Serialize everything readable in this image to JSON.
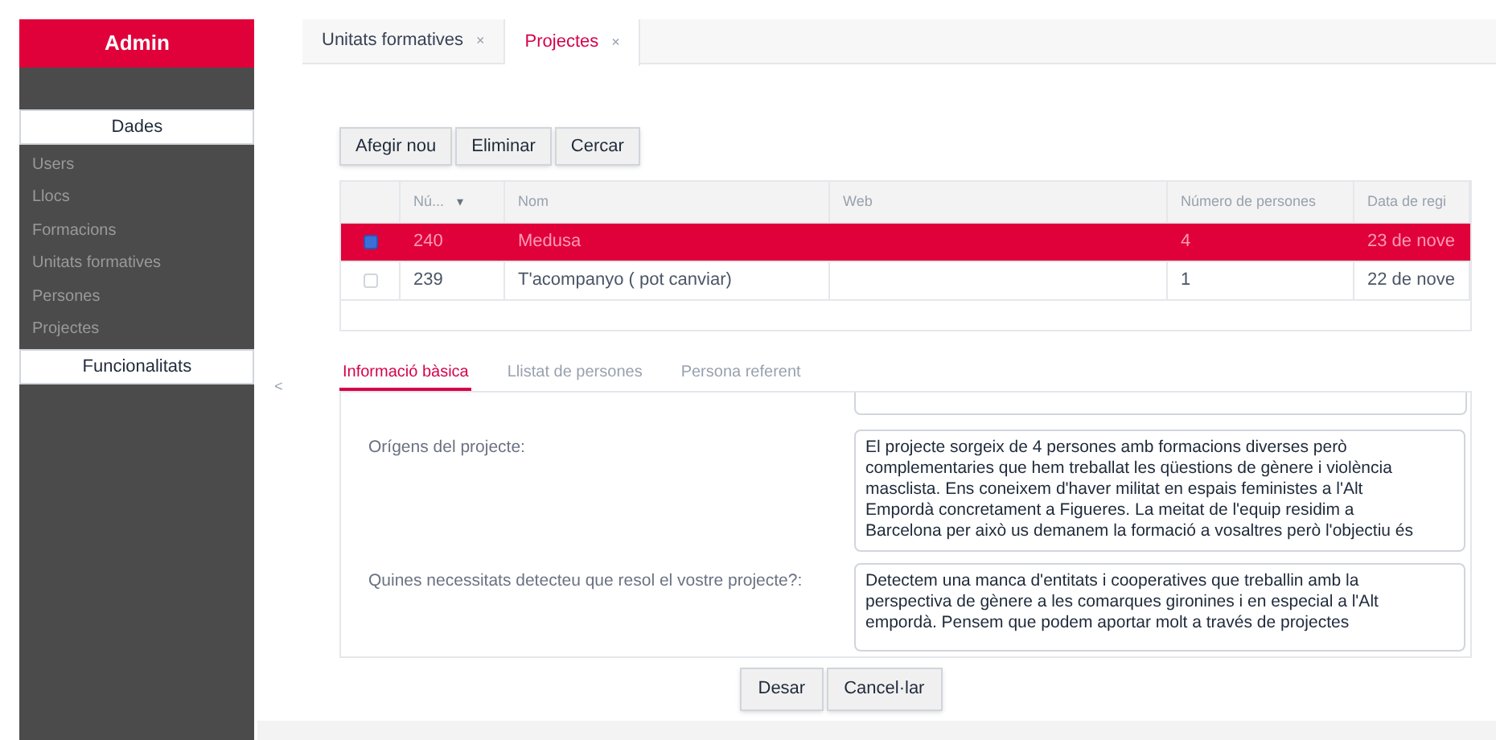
{
  "sidebar": {
    "title": "Admin",
    "sections": [
      {
        "label": "Dades",
        "items": [
          "Users",
          "Llocs",
          "Formacions",
          "Unitats formatives",
          "Persones",
          "Projectes"
        ]
      },
      {
        "label": "Funcionalitats"
      }
    ],
    "collapse_toggle": "<"
  },
  "tabs": [
    {
      "label": "Unitats formatives",
      "close": "×",
      "selected": false
    },
    {
      "label": "Projectes",
      "close": "×",
      "selected": true
    }
  ],
  "toolbar": [
    "Afegir nou",
    "Eliminar",
    "Cercar"
  ],
  "table": {
    "columns": [
      "",
      "Nú...",
      "Nom",
      "Web",
      "Número de persones",
      "Data de regi"
    ],
    "sort_indicator": "▾",
    "rows": [
      {
        "selected": true,
        "cells": [
          "",
          "240",
          "Medusa",
          "",
          "4",
          "23 de nove"
        ]
      },
      {
        "selected": false,
        "cells": [
          "",
          "239",
          "T'acompanyo ( pot canviar)",
          "",
          "1",
          "22 de nove"
        ]
      }
    ]
  },
  "detail_tabs": [
    {
      "label": "Informació bàsica",
      "selected": true
    },
    {
      "label": "Llistat de persones",
      "selected": false
    },
    {
      "label": "Persona referent",
      "selected": false
    }
  ],
  "form": [
    {
      "label": "Orígens del projecte:",
      "lines": [
        "El projecte sorgeix de 4 persones amb formacions diverses però",
        "complementaries que hem treballat les qüestions de gènere i violència",
        "masclista. Ens coneixem d'haver militat en espais feministes a l'Alt",
        "Empordà concretament a Figueres. La meitat de l'equip residim a",
        "Barcelona per això us demanem la formació a vosaltres però l'objectiu és"
      ]
    },
    {
      "label": "Quines necessitats detecteu que resol el vostre projecte?:",
      "lines": [
        "Detectem una manca d'entitats i cooperatives que treballin amb la",
        "perspectiva de gènere a les comarques gironines i en especial a l'Alt",
        "empordà. Pensem que podem aportar molt a través de projectes"
      ]
    }
  ],
  "actions": [
    "Desar",
    "Cancel·lar"
  ]
}
